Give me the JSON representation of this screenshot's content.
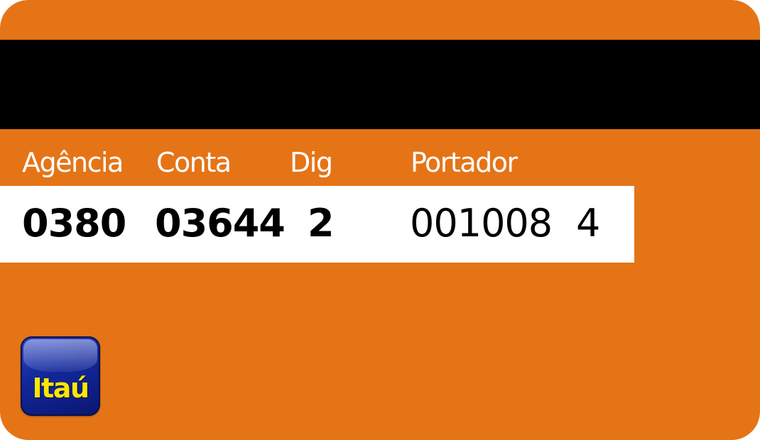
{
  "card": {
    "labels": {
      "agencia": "Agência",
      "conta": "Conta",
      "dig": "Dig",
      "portador": "Portador"
    },
    "values": {
      "agencia": "0380",
      "conta": "03644",
      "dig": "2",
      "portador_number": "001008",
      "portador_digit": "4"
    },
    "logo_text": "Itaú",
    "colors": {
      "card_background": "#E57417",
      "magnetic_stripe": "#000000",
      "value_band": "#FFFFFF",
      "logo_background": "#12279A",
      "logo_text": "#FFE600"
    }
  }
}
